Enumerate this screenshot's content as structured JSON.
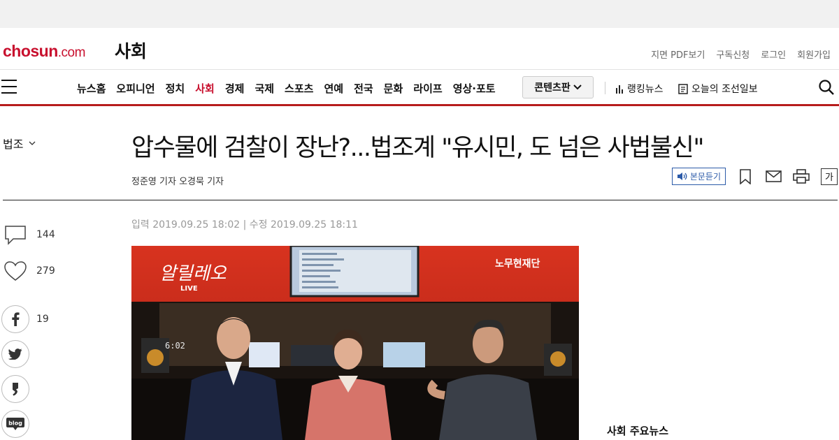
{
  "masthead": {
    "logo_main": "chosun",
    "logo_suffix": ".com",
    "section": "사회",
    "util_links": [
      "지면 PDF보기",
      "구독신청",
      "로그인",
      "회원가입"
    ]
  },
  "nav": {
    "items": [
      "뉴스홈",
      "오피니언",
      "정치",
      "사회",
      "경제",
      "국제",
      "스포츠",
      "연예",
      "전국",
      "문화",
      "라이프",
      "영상·포토"
    ],
    "active": "사회",
    "content_button": "콘텐츠판",
    "ranking": "랭킹뉴스",
    "today_paper": "오늘의 조선일보"
  },
  "article": {
    "category": "법조",
    "headline": "압수물에 검찰이 장난?...법조계 \"유시민, 도 넘은 사법불신\"",
    "byline": "정준영 기자  오경묵 기자",
    "listen_label": "본문듣기",
    "font_label": "가",
    "dates": "입력 2019.09.25 18:02 | 수정 2019.09.25 18:11"
  },
  "photo": {
    "logo_text": "알릴레오",
    "logo_sub": "LIVE",
    "foundation": "노무현재단",
    "clock": "6:02"
  },
  "share": {
    "comments": "144",
    "likes": "279",
    "facebook": "19",
    "blog_label": "blog"
  },
  "sidebar": {
    "title": "사회 주요뉴스"
  },
  "colors": {
    "brand": "#c8102e",
    "nav_border": "#b71c1c",
    "listen_blue": "#2b5aa8"
  }
}
